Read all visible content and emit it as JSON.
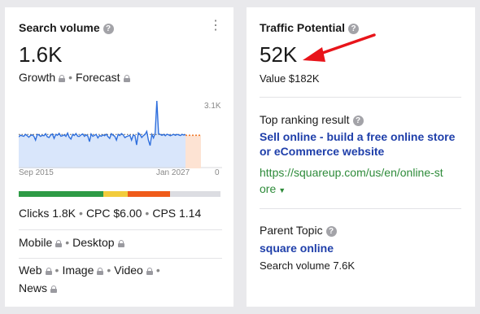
{
  "search_volume": {
    "title": "Search volume",
    "help_icon": "?",
    "value": "1.6K",
    "growth_label": "Growth",
    "forecast_label": "Forecast",
    "axis_top": "3.1K",
    "axis_bottom": "0",
    "date_start": "Sep 2015",
    "date_end": "Jan 2027",
    "difficulty_bar": [
      {
        "color": "#2e9b46",
        "fraction": 0.42
      },
      {
        "color": "#f2cc3c",
        "fraction": 0.12
      },
      {
        "color": "#ef5b1a",
        "fraction": 0.21
      },
      {
        "color": "#dcdde2",
        "fraction": 0.25
      }
    ],
    "clicks": "Clicks 1.8K",
    "cpc": "CPC $6.00",
    "cps": "CPS 1.14",
    "mobile": "Mobile",
    "desktop": "Desktop",
    "web": "Web",
    "image": "Image",
    "video": "Video",
    "news": "News",
    "chart_series": [
      1450,
      1520,
      1500,
      1470,
      1560,
      1500,
      1430,
      1510,
      1540,
      1480,
      1300,
      1560,
      1540,
      1470,
      1520,
      1500,
      1590,
      1450,
      1420,
      1530,
      1580,
      1380,
      1560,
      1520,
      1610,
      1480,
      1500,
      1540,
      1470,
      1620,
      1430,
      1350,
      1560,
      1510,
      1600,
      1480,
      1470,
      1540,
      1580,
      1470,
      1540,
      1490,
      1230,
      1580,
      1470,
      1520,
      1560,
      1400,
      1510,
      1480,
      1540,
      1500,
      1570,
      1460,
      1380,
      1590,
      1520,
      1480,
      1300,
      1560,
      1510,
      1600,
      1540,
      1410,
      1460,
      1490,
      1520,
      1300,
      1530,
      1500,
      1080,
      1630,
      1560,
      1420,
      1500,
      1560,
      1700,
      1300,
      1050,
      1560,
      1400,
      1620,
      3100,
      1600,
      1560,
      1520,
      1560,
      1500,
      1570,
      1540,
      1500,
      1530,
      1560,
      1520,
      1560,
      1540,
      1510,
      1560,
      1530,
      1550
    ]
  },
  "traffic": {
    "title": "Traffic Potential",
    "help_icon": "?",
    "value": "52K",
    "value_line": "Value $182K",
    "top_result_label": "Top ranking result",
    "top_result_title_1": "Sell online - build a free online store",
    "top_result_title_2": "or eCommerce website",
    "top_result_url_1": "https://squareup.com/us/en/online-st",
    "top_result_url_2": "ore",
    "parent_topic_label": "Parent Topic",
    "parent_topic": "square online",
    "parent_volume": "Search volume 7.6K"
  }
}
